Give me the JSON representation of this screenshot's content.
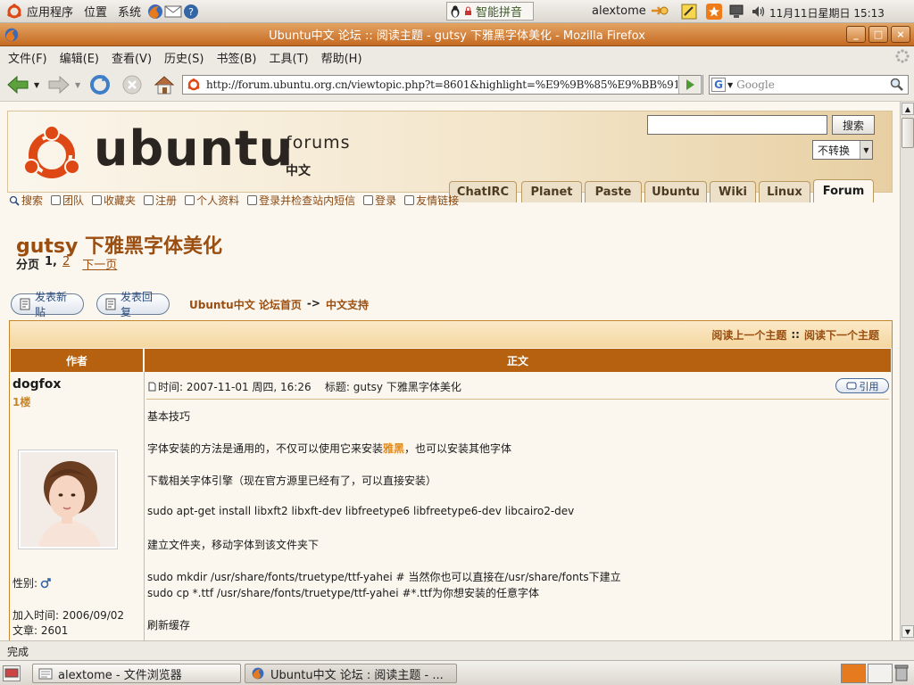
{
  "top_panel": {
    "applications": "应用程序",
    "places": "位置",
    "system": "系统",
    "ime": "智能拼音",
    "user": "alextome",
    "datetime": "11月11日星期日 15:13"
  },
  "window": {
    "title": "Ubuntu中文 论坛 :: 阅读主题 - gutsy 下雅黑字体美化 - Mozilla Firefox"
  },
  "menubar": {
    "items": [
      "文件(F)",
      "编辑(E)",
      "查看(V)",
      "历史(S)",
      "书签(B)",
      "工具(T)",
      "帮助(H)"
    ]
  },
  "navbar": {
    "url": "http://forum.ubuntu.org.cn/viewtopic.php?t=8601&highlight=%E9%9B%85%E9%BB%91",
    "search_placeholder": "Google"
  },
  "forum": {
    "logo_text": "ubuntu",
    "forums_label": "forums",
    "lang_label": "中文",
    "search_button": "搜索",
    "convert_select": "不转换",
    "tabs": [
      "ChatIRC",
      "Planet",
      "Paste",
      "Ubuntu",
      "Wiki",
      "Linux",
      "Forum"
    ],
    "nav_links": [
      "搜索",
      "团队",
      "收藏夹",
      "注册",
      "个人资料",
      "登录并检查站内短信",
      "登录",
      "友情链接"
    ],
    "topic_title": "gutsy 下雅黑字体美化",
    "pages_label": "分页",
    "page_current": "1,",
    "page_2": "2",
    "next_page": "下一页",
    "new_topic_btn": "发表新贴",
    "reply_btn": "发表回复",
    "breadcrumb_home": "Ubuntu中文 论坛首页",
    "breadcrumb_sep": "->",
    "breadcrumb_forum": "中文支持",
    "prev_topic": "阅读上一个主题",
    "topic_sep": "::",
    "next_topic": "阅读下一个主题",
    "col_author": "作者",
    "col_body": "正文",
    "post": {
      "author": "dogfox",
      "floor": "1楼",
      "gender_label": "性别:",
      "joined": "加入时间: 2006/09/02",
      "posts": "文章: 2601",
      "meta": "时间: 2007-11-01 周四, 16:26    标题: gutsy 下雅黑字体美化",
      "quote_btn": "引用",
      "lines": [
        "基本技巧",
        "字体安装的方法是通用的，不仅可以使用它来安装",
        "下载相关字体引擎（现在官方源里已经有了，可以直接安装）",
        "sudo apt-get install libxft2 libxft-dev libfreetype6 libfreetype6-dev libcairo2-dev",
        "建立文件夹，移动字体到该文件夹下",
        "sudo mkdir /usr/share/fonts/truetype/ttf-yahei # 当然你也可以直接在/usr/share/fonts下建立",
        "sudo cp *.ttf /usr/share/fonts/truetype/ttf-yahei #*.ttf为你想安装的任意字体",
        "刷新缓存"
      ],
      "highlight": "雅黑",
      "line2_suffix": "，也可以安装其他字体"
    }
  },
  "status": {
    "text": "完成"
  },
  "taskbar": {
    "items": [
      "alextome - 文件浏览器",
      "Ubuntu中文 论坛 : 阅读主题 - ..."
    ]
  },
  "colors": {
    "accent": "#b5610f",
    "brand_orange": "#dd4814",
    "header_bar": "#b5610f"
  }
}
